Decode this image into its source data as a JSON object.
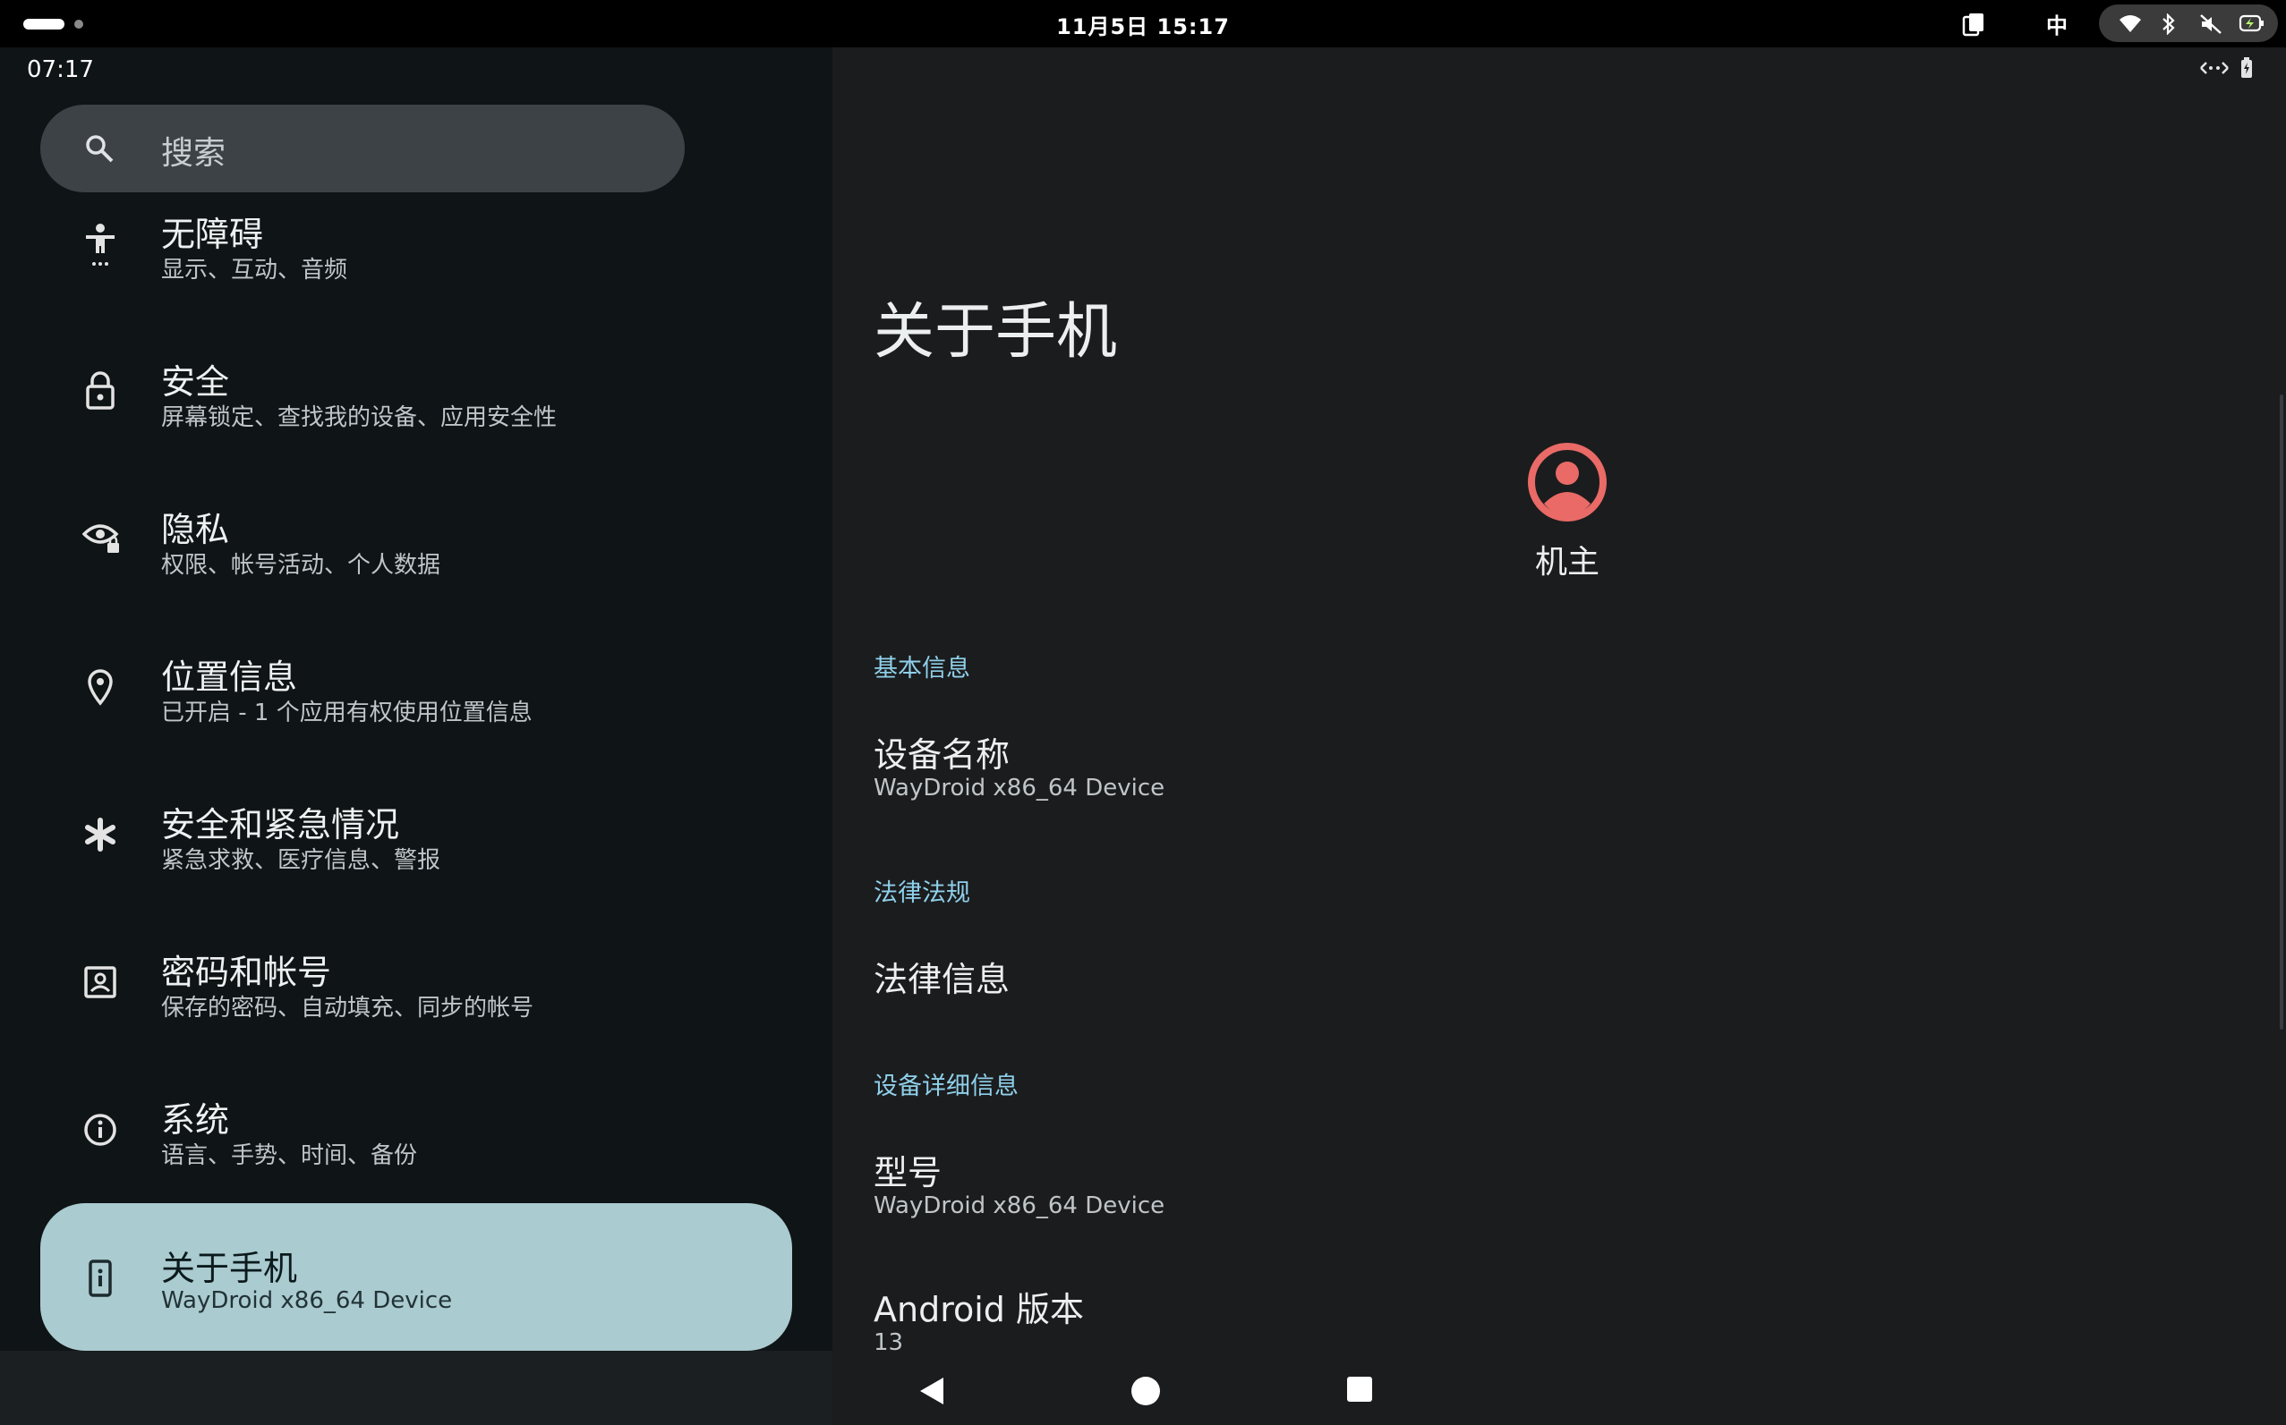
{
  "desktop_bar": {
    "datetime": "11月5日  15:17",
    "ime": "中",
    "icons": [
      "clipboard-icon",
      "wifi-icon",
      "bluetooth-icon",
      "volume-muted-icon",
      "battery-charging-icon"
    ]
  },
  "android_status": {
    "time": "07:17",
    "icons": [
      "data-saver-icon",
      "battery-icon"
    ]
  },
  "search": {
    "placeholder": "搜索"
  },
  "sidebar": {
    "items": [
      {
        "icon": "accessibility-icon",
        "title": "无障碍",
        "subtitle": "显示、互动、音频"
      },
      {
        "icon": "lock-icon",
        "title": "安全",
        "subtitle": "屏幕锁定、查找我的设备、应用安全性"
      },
      {
        "icon": "privacy-eye-icon",
        "title": "隐私",
        "subtitle": "权限、帐号活动、个人数据"
      },
      {
        "icon": "location-pin-icon",
        "title": "位置信息",
        "subtitle": "已开启 - 1 个应用有权使用位置信息"
      },
      {
        "icon": "emergency-asterisk-icon",
        "title": "安全和紧急情况",
        "subtitle": "紧急求救、医疗信息、警报"
      },
      {
        "icon": "account-box-icon",
        "title": "密码和帐号",
        "subtitle": "保存的密码、自动填充、同步的帐号"
      },
      {
        "icon": "info-icon",
        "title": "系统",
        "subtitle": "语言、手势、时间、备份"
      },
      {
        "icon": "phone-info-icon",
        "title": "关于手机",
        "subtitle": "WayDroid x86_64 Device",
        "selected": true
      }
    ]
  },
  "main": {
    "title": "关于手机",
    "owner": "机主",
    "sections": {
      "basic": "基本信息",
      "legal": "法律法规",
      "details": "设备详细信息"
    },
    "device_name": {
      "title": "设备名称",
      "summary": "WayDroid x86_64 Device"
    },
    "legal_info": {
      "title": "法律信息"
    },
    "model": {
      "title": "型号",
      "summary": "WayDroid x86_64 Device"
    },
    "android_version": {
      "title": "Android 版本",
      "summary": "13"
    }
  },
  "navbar": {
    "buttons": [
      "back-icon",
      "home-icon",
      "recents-icon"
    ]
  },
  "colors": {
    "accent": "#8fd0ea",
    "selected_bg": "#aacbd0",
    "avatar": "#e96a66",
    "left_bg": "#0f1416",
    "right_bg": "#1b1c1e"
  }
}
